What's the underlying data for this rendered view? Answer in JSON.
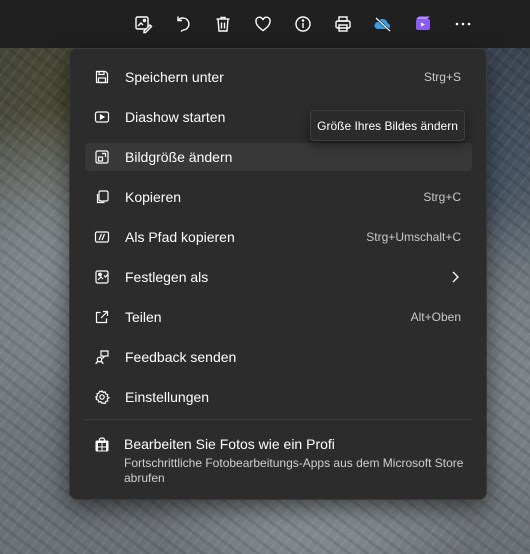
{
  "toolbar": {
    "buttons": [
      {
        "name": "edit-image-icon"
      },
      {
        "name": "rotate-icon"
      },
      {
        "name": "delete-icon"
      },
      {
        "name": "favorite-heart-icon"
      },
      {
        "name": "info-icon"
      },
      {
        "name": "print-icon"
      },
      {
        "name": "onedrive-cloud-icon"
      },
      {
        "name": "clipchamp-icon"
      },
      {
        "name": "more-options-icon"
      }
    ],
    "more_label": "···"
  },
  "menu": {
    "items": [
      {
        "label": "Speichern unter",
        "shortcut": "Strg+S",
        "icon": "save-icon"
      },
      {
        "label": "Diashow starten",
        "shortcut": "",
        "icon": "slideshow-icon"
      },
      {
        "label": "Bildgröße ändern",
        "shortcut": "",
        "icon": "resize-icon"
      },
      {
        "label": "Kopieren",
        "shortcut": "Strg+C",
        "icon": "copy-icon"
      },
      {
        "label": "Als Pfad kopieren",
        "shortcut": "Strg+Umschalt+C",
        "icon": "copy-path-icon"
      },
      {
        "label": "Festlegen als",
        "shortcut": "",
        "icon": "set-as-icon"
      },
      {
        "label": "Teilen",
        "shortcut": "Alt+Oben",
        "icon": "share-icon"
      },
      {
        "label": "Feedback senden",
        "shortcut": "",
        "icon": "feedback-icon"
      },
      {
        "label": "Einstellungen",
        "shortcut": "",
        "icon": "settings-icon"
      }
    ],
    "promo": {
      "title": "Bearbeiten Sie Fotos wie ein Profi",
      "description": "Fortschrittliche Fotobearbeitungs-Apps aus dem Microsoft Store abrufen",
      "icon": "store-icon"
    }
  },
  "tooltip": {
    "text": "Größe Ihres Bildes ändern"
  },
  "colors": {
    "onedrive_icon": "#3b9ee8",
    "clipchamp_icon": "#8a5cf6",
    "menu_bg": "#2c2c2c",
    "hover_bg": "#383838"
  }
}
